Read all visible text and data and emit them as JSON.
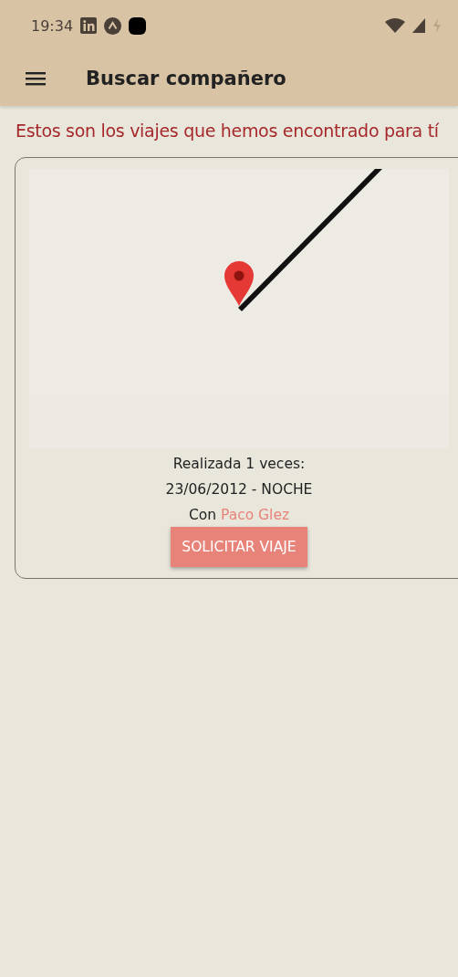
{
  "status_bar": {
    "time": "19:34"
  },
  "app_bar": {
    "title": "Buscar compañero"
  },
  "heading": "Estos son los viajes que hemos encontrado para tí",
  "trips": [
    {
      "times": "Realizada 1 veces:",
      "date": "23/06/2012 - NOCHE",
      "with_label": "Con",
      "driver": "Paco Glez",
      "button": "SOLICITAR VIAJE"
    }
  ]
}
